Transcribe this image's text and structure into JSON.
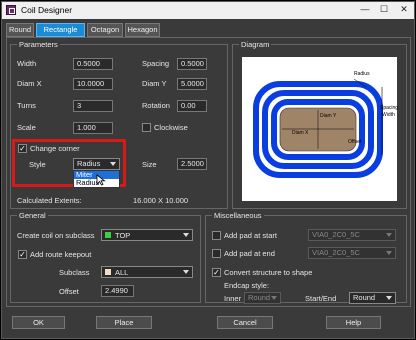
{
  "window": {
    "title": "Coil Designer",
    "minimize": "—",
    "maximize": "☐",
    "close": "✕"
  },
  "tabs": [
    {
      "label": "Round",
      "active": false
    },
    {
      "label": "Rectangle",
      "active": true
    },
    {
      "label": "Octagon",
      "active": false
    },
    {
      "label": "Hexagon",
      "active": false
    }
  ],
  "parameters": {
    "legend": "Parameters",
    "width_label": "Width",
    "width_value": "0.5000",
    "spacing_label": "Spacing",
    "spacing_value": "0.5000",
    "diamx_label": "Diam X",
    "diamx_value": "10.0000",
    "diamy_label": "Diam Y",
    "diamy_value": "5.0000",
    "turns_label": "Turns",
    "turns_value": "3",
    "rotation_label": "Rotation",
    "rotation_value": "0.00",
    "scale_label": "Scale",
    "scale_value": "1.000",
    "clockwise_label": "Clockwise",
    "change_corner_label": "Change corner",
    "style_label": "Style",
    "style_value": "Radius",
    "style_options": [
      "Miter",
      "Radius"
    ],
    "size_label": "Size",
    "size_value": "2.5000",
    "extents_label": "Calculated Extents:",
    "extents_value": "16.000 X 10.000"
  },
  "diagram": {
    "legend": "Diagram",
    "radius_label": "Radius",
    "spacing_label": "Spacing",
    "width_label": "Width",
    "diamy_label": "Diam Y",
    "diamx_label": "Diam X",
    "offset_label": "Offset",
    "trace_color": "#0a3ee0",
    "core_color": "#a08468"
  },
  "general": {
    "legend": "General",
    "create_on_label": "Create coil on subclass",
    "create_on_value": "TOP",
    "create_on_color": "#3ccf3c",
    "route_keepout_label": "Add route keepout",
    "subclass_label": "Subclass",
    "subclass_value": "ALL",
    "subclass_color": "#f0e0c0",
    "offset_label": "Offset",
    "offset_value": "2.4990"
  },
  "misc": {
    "legend": "Miscellaneous",
    "pad_start_label": "Add pad at start",
    "pad_start_value": "VIA0_2C0_5C",
    "pad_end_label": "Add pad at end",
    "pad_end_value": "VIA0_2C0_5C",
    "convert_label": "Convert structure to shape",
    "endcap_label": "Endcap style:",
    "inner_label": "Inner",
    "inner_value": "Round",
    "startend_label": "Start/End",
    "startend_value": "Round"
  },
  "buttons": {
    "ok": "OK",
    "place": "Place",
    "cancel": "Cancel",
    "help": "Help"
  }
}
